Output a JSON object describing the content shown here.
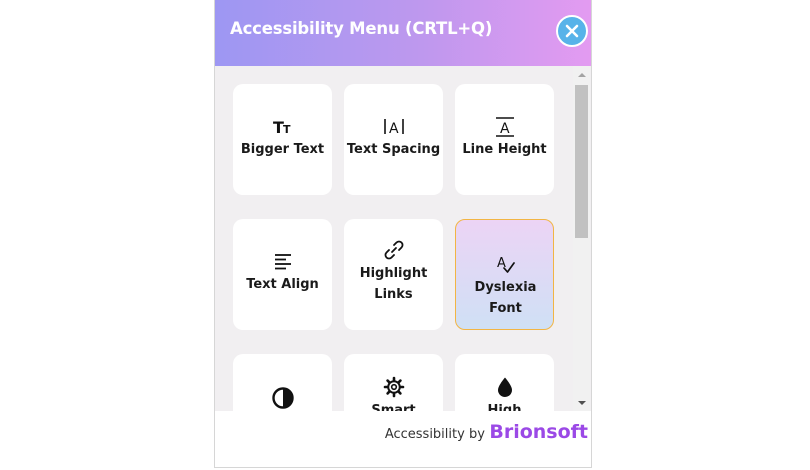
{
  "header": {
    "title": "Accessibility Menu (CRTL+Q)",
    "close_icon": "close-icon"
  },
  "features": [
    {
      "label": "Bigger Text",
      "icon": "text-size-icon",
      "icon_text": "Tт",
      "active": false
    },
    {
      "label": "Text Spacing",
      "icon": "text-spacing-icon",
      "icon_text": "|A|",
      "active": false
    },
    {
      "label": "Line Height",
      "icon": "line-height-icon",
      "icon_text": "A",
      "active": false
    },
    {
      "label": "Text Align",
      "icon": "align-left-icon",
      "active": false
    },
    {
      "label_lines": [
        "Highlight",
        "Links"
      ],
      "icon": "link-icon",
      "active": false
    },
    {
      "label": "Dyslexia Font",
      "icon": "spell-check-icon",
      "icon_text": "A",
      "active": true
    },
    {
      "label": "",
      "icon": "contrast-icon",
      "active": false
    },
    {
      "label": "Smart",
      "icon": "gear-icon",
      "active": false
    },
    {
      "label": "High",
      "icon": "drop-icon",
      "active": false
    }
  ],
  "footer": {
    "prefix": "Accessibility by",
    "brand": "Brionsoft"
  },
  "colors": {
    "header_gradient_start": "#9d97f3",
    "header_gradient_end": "#e39bf1",
    "close_button": "#58b3e9",
    "active_border": "#f2b544",
    "brand": "#9b49e6"
  }
}
